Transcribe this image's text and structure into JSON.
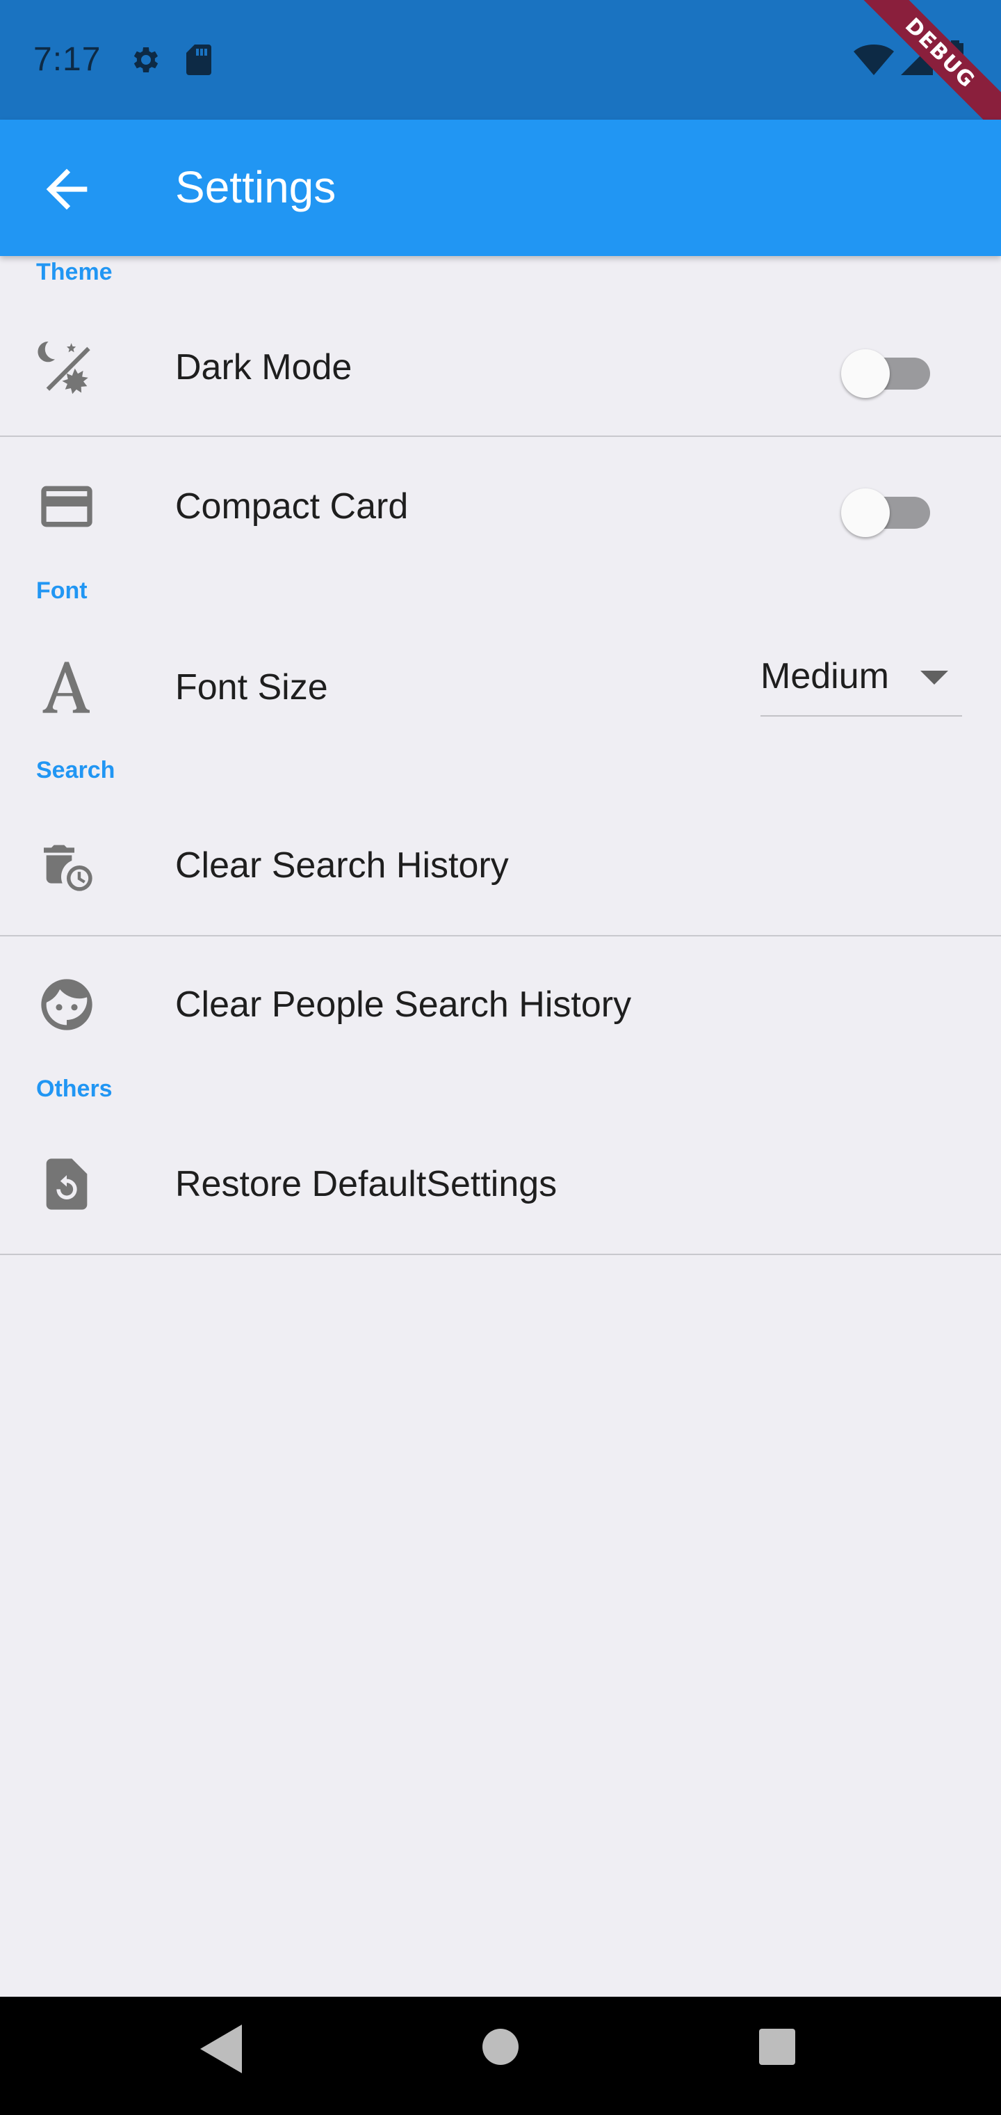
{
  "status_bar": {
    "time": "7:17",
    "icons": [
      "gear-icon",
      "sd-card-icon",
      "wifi-icon",
      "signal-icon",
      "battery-icon"
    ],
    "debug_banner": "DEBUG"
  },
  "app_bar": {
    "title": "Settings",
    "back_icon": "arrow-back-icon",
    "color": "#2196f3"
  },
  "sections": {
    "theme": {
      "header": "Theme",
      "dark_mode": {
        "label": "Dark Mode",
        "icon": "dark-mode-icon",
        "enabled": false
      },
      "compact_card": {
        "label": "Compact Card",
        "icon": "credit-card-icon",
        "enabled": false
      }
    },
    "font": {
      "header": "Font",
      "font_size": {
        "label": "Font Size",
        "icon": "font-letter-icon",
        "selected": "Medium"
      }
    },
    "search": {
      "header": "Search",
      "clear_search": {
        "label": "Clear Search History",
        "icon": "delete-history-icon"
      },
      "clear_people": {
        "label": "Clear People Search History",
        "icon": "face-icon"
      }
    },
    "others": {
      "header": "Others",
      "restore": {
        "label": "Restore DefaultSettings",
        "icon": "restore-file-icon"
      }
    }
  },
  "nav_bar": {
    "icons": [
      "nav-back-icon",
      "nav-home-icon",
      "nav-recents-icon"
    ]
  },
  "colors": {
    "accent": "#2196f3",
    "status_bar": "#1a73c1",
    "background": "#efeef3",
    "icon_gray": "#757575"
  }
}
